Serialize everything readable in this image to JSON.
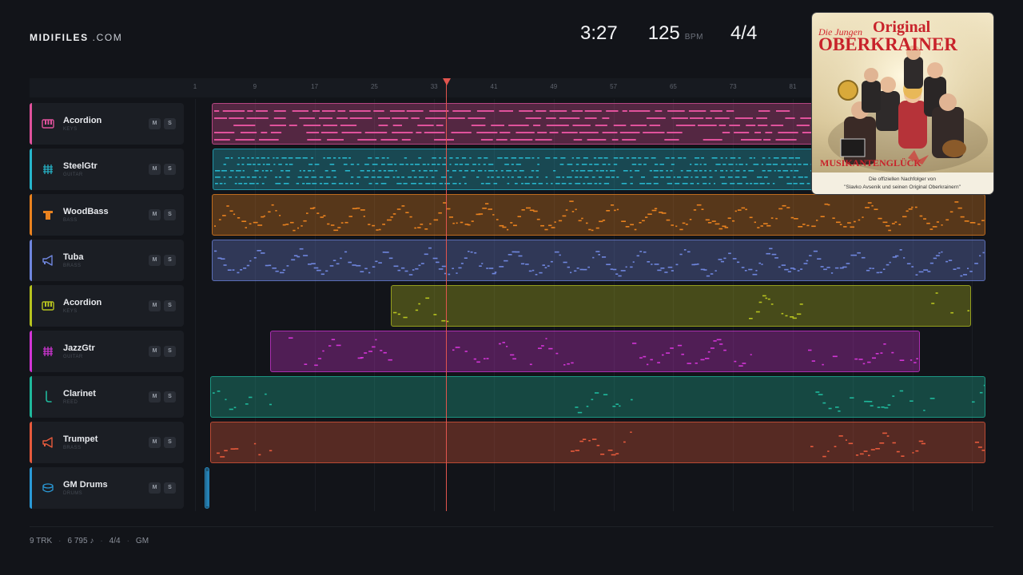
{
  "brand": {
    "name_bold": "MIDIFILES",
    "name_light": " .COM"
  },
  "transport": {
    "time": "3:27",
    "tempo": "125",
    "tempo_unit": "BPM",
    "signature": "4/4"
  },
  "ruler": {
    "ticks": [
      "1",
      "9",
      "17",
      "25",
      "33",
      "41",
      "49",
      "57",
      "65",
      "73",
      "81"
    ]
  },
  "playhead_position": 0.3,
  "tracks": [
    {
      "name": "Acordion",
      "category": "KEYS",
      "color": "#e0529c",
      "icon": "piano-keys-icon",
      "mute": "M",
      "solo": "S"
    },
    {
      "name": "SteelGtr",
      "category": "GUITAR",
      "color": "#27b6cc",
      "icon": "guitar-grid-icon",
      "mute": "M",
      "solo": "S"
    },
    {
      "name": "WoodBass",
      "category": "BASS",
      "color": "#e9821f",
      "icon": "bass-icon",
      "mute": "M",
      "solo": "S"
    },
    {
      "name": "Tuba",
      "category": "BRASS",
      "color": "#6f86de",
      "icon": "horn-icon",
      "mute": "M",
      "solo": "S"
    },
    {
      "name": "Acordion",
      "category": "KEYS",
      "color": "#b6c21f",
      "icon": "piano-keys-icon",
      "mute": "M",
      "solo": "S"
    },
    {
      "name": "JazzGtr",
      "category": "GUITAR",
      "color": "#d235d6",
      "icon": "guitar-grid-icon",
      "mute": "M",
      "solo": "S"
    },
    {
      "name": "Clarinet",
      "category": "REED",
      "color": "#1fb89c",
      "icon": "clarinet-icon",
      "mute": "M",
      "solo": "S"
    },
    {
      "name": "Trumpet",
      "category": "BRASS",
      "color": "#e65a3c",
      "icon": "horn-icon",
      "mute": "M",
      "solo": "S"
    },
    {
      "name": "GM Drums",
      "category": "DRUMS",
      "color": "#2a9ad8",
      "icon": "drum-icon",
      "mute": "M",
      "solo": "S"
    }
  ],
  "album": {
    "line1": "Die Jungen",
    "line2": "Original",
    "line3": "OBERKRAINER",
    "banner": "MUSIKANTENGLÜCK",
    "caption1": "Die offiziellen Nachfolger von",
    "caption2": "\"Slavko Avsenik und seinen Original Oberkrainern\""
  },
  "footer": {
    "tracks": "9 TRK",
    "notes": "6 795 ♪",
    "signature": "4/4",
    "standard": "GM"
  }
}
